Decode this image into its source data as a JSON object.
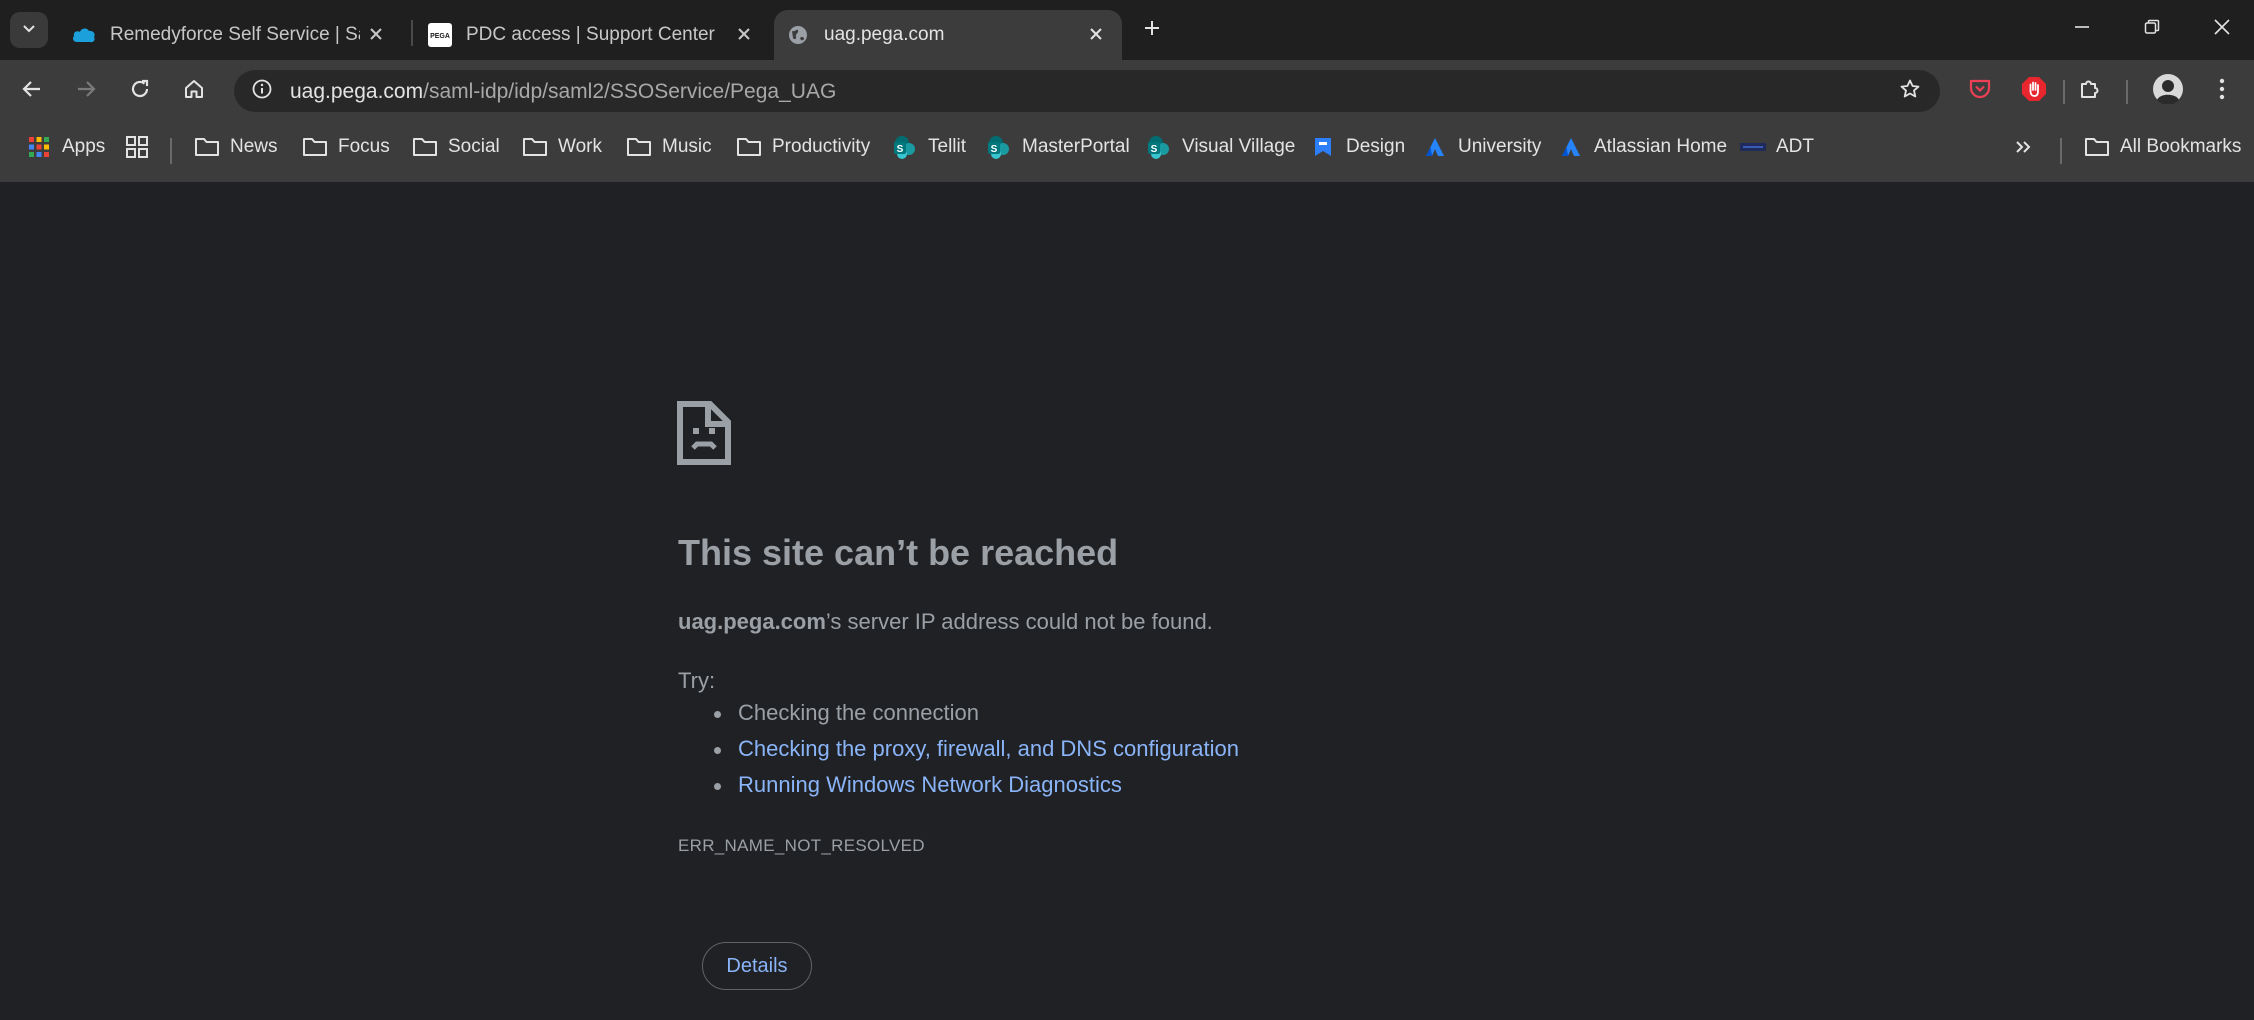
{
  "tabs": [
    {
      "title": "Remedyforce Self Service | Sales",
      "favicon": "salesforce-cloud-icon"
    },
    {
      "title": "PDC access | Support Center",
      "favicon": "pega-logo-icon"
    },
    {
      "title": "uag.pega.com",
      "favicon": "globe-icon",
      "active": true
    }
  ],
  "new_tab_label": "+",
  "address": {
    "host": "uag.pega.com",
    "path": "/saml-idp/idp/saml2/SSOService/Pega_UAG"
  },
  "bookmarks": [
    {
      "label": "Apps",
      "icon": "apps-grid-icon"
    },
    {
      "label": "",
      "icon": "tab-groups-icon"
    },
    {
      "label": "News",
      "icon": "folder-icon"
    },
    {
      "label": "Focus",
      "icon": "folder-icon"
    },
    {
      "label": "Social",
      "icon": "folder-icon"
    },
    {
      "label": "Work",
      "icon": "folder-icon"
    },
    {
      "label": "Music",
      "icon": "folder-icon"
    },
    {
      "label": "Productivity",
      "icon": "folder-icon"
    },
    {
      "label": "Tellit",
      "icon": "sharepoint-icon"
    },
    {
      "label": "MasterPortal",
      "icon": "sharepoint-icon"
    },
    {
      "label": "Visual Village",
      "icon": "sharepoint-icon"
    },
    {
      "label": "Design",
      "icon": "bookmark-site-icon"
    },
    {
      "label": "University",
      "icon": "atlassian-icon"
    },
    {
      "label": "Atlassian Home",
      "icon": "atlassian-icon"
    },
    {
      "label": "ADT",
      "icon": "adt-icon"
    }
  ],
  "all_bookmarks_label": "All Bookmarks",
  "error": {
    "title": "This site can’t be reached",
    "host": "uag.pega.com",
    "description_suffix": "’s server IP address could not be found.",
    "try_label": "Try:",
    "suggestions": [
      {
        "text": "Checking the connection",
        "link": false
      },
      {
        "text": "Checking the proxy, firewall, and DNS configuration",
        "link": true
      },
      {
        "text": "Running Windows Network Diagnostics",
        "link": true
      }
    ],
    "code": "ERR_NAME_NOT_RESOLVED",
    "details_button": "Details"
  },
  "colors": {
    "background": "#202124",
    "toolbar": "#3c3c3c",
    "link": "#8ab4f8",
    "text": "#9aa0a6"
  }
}
